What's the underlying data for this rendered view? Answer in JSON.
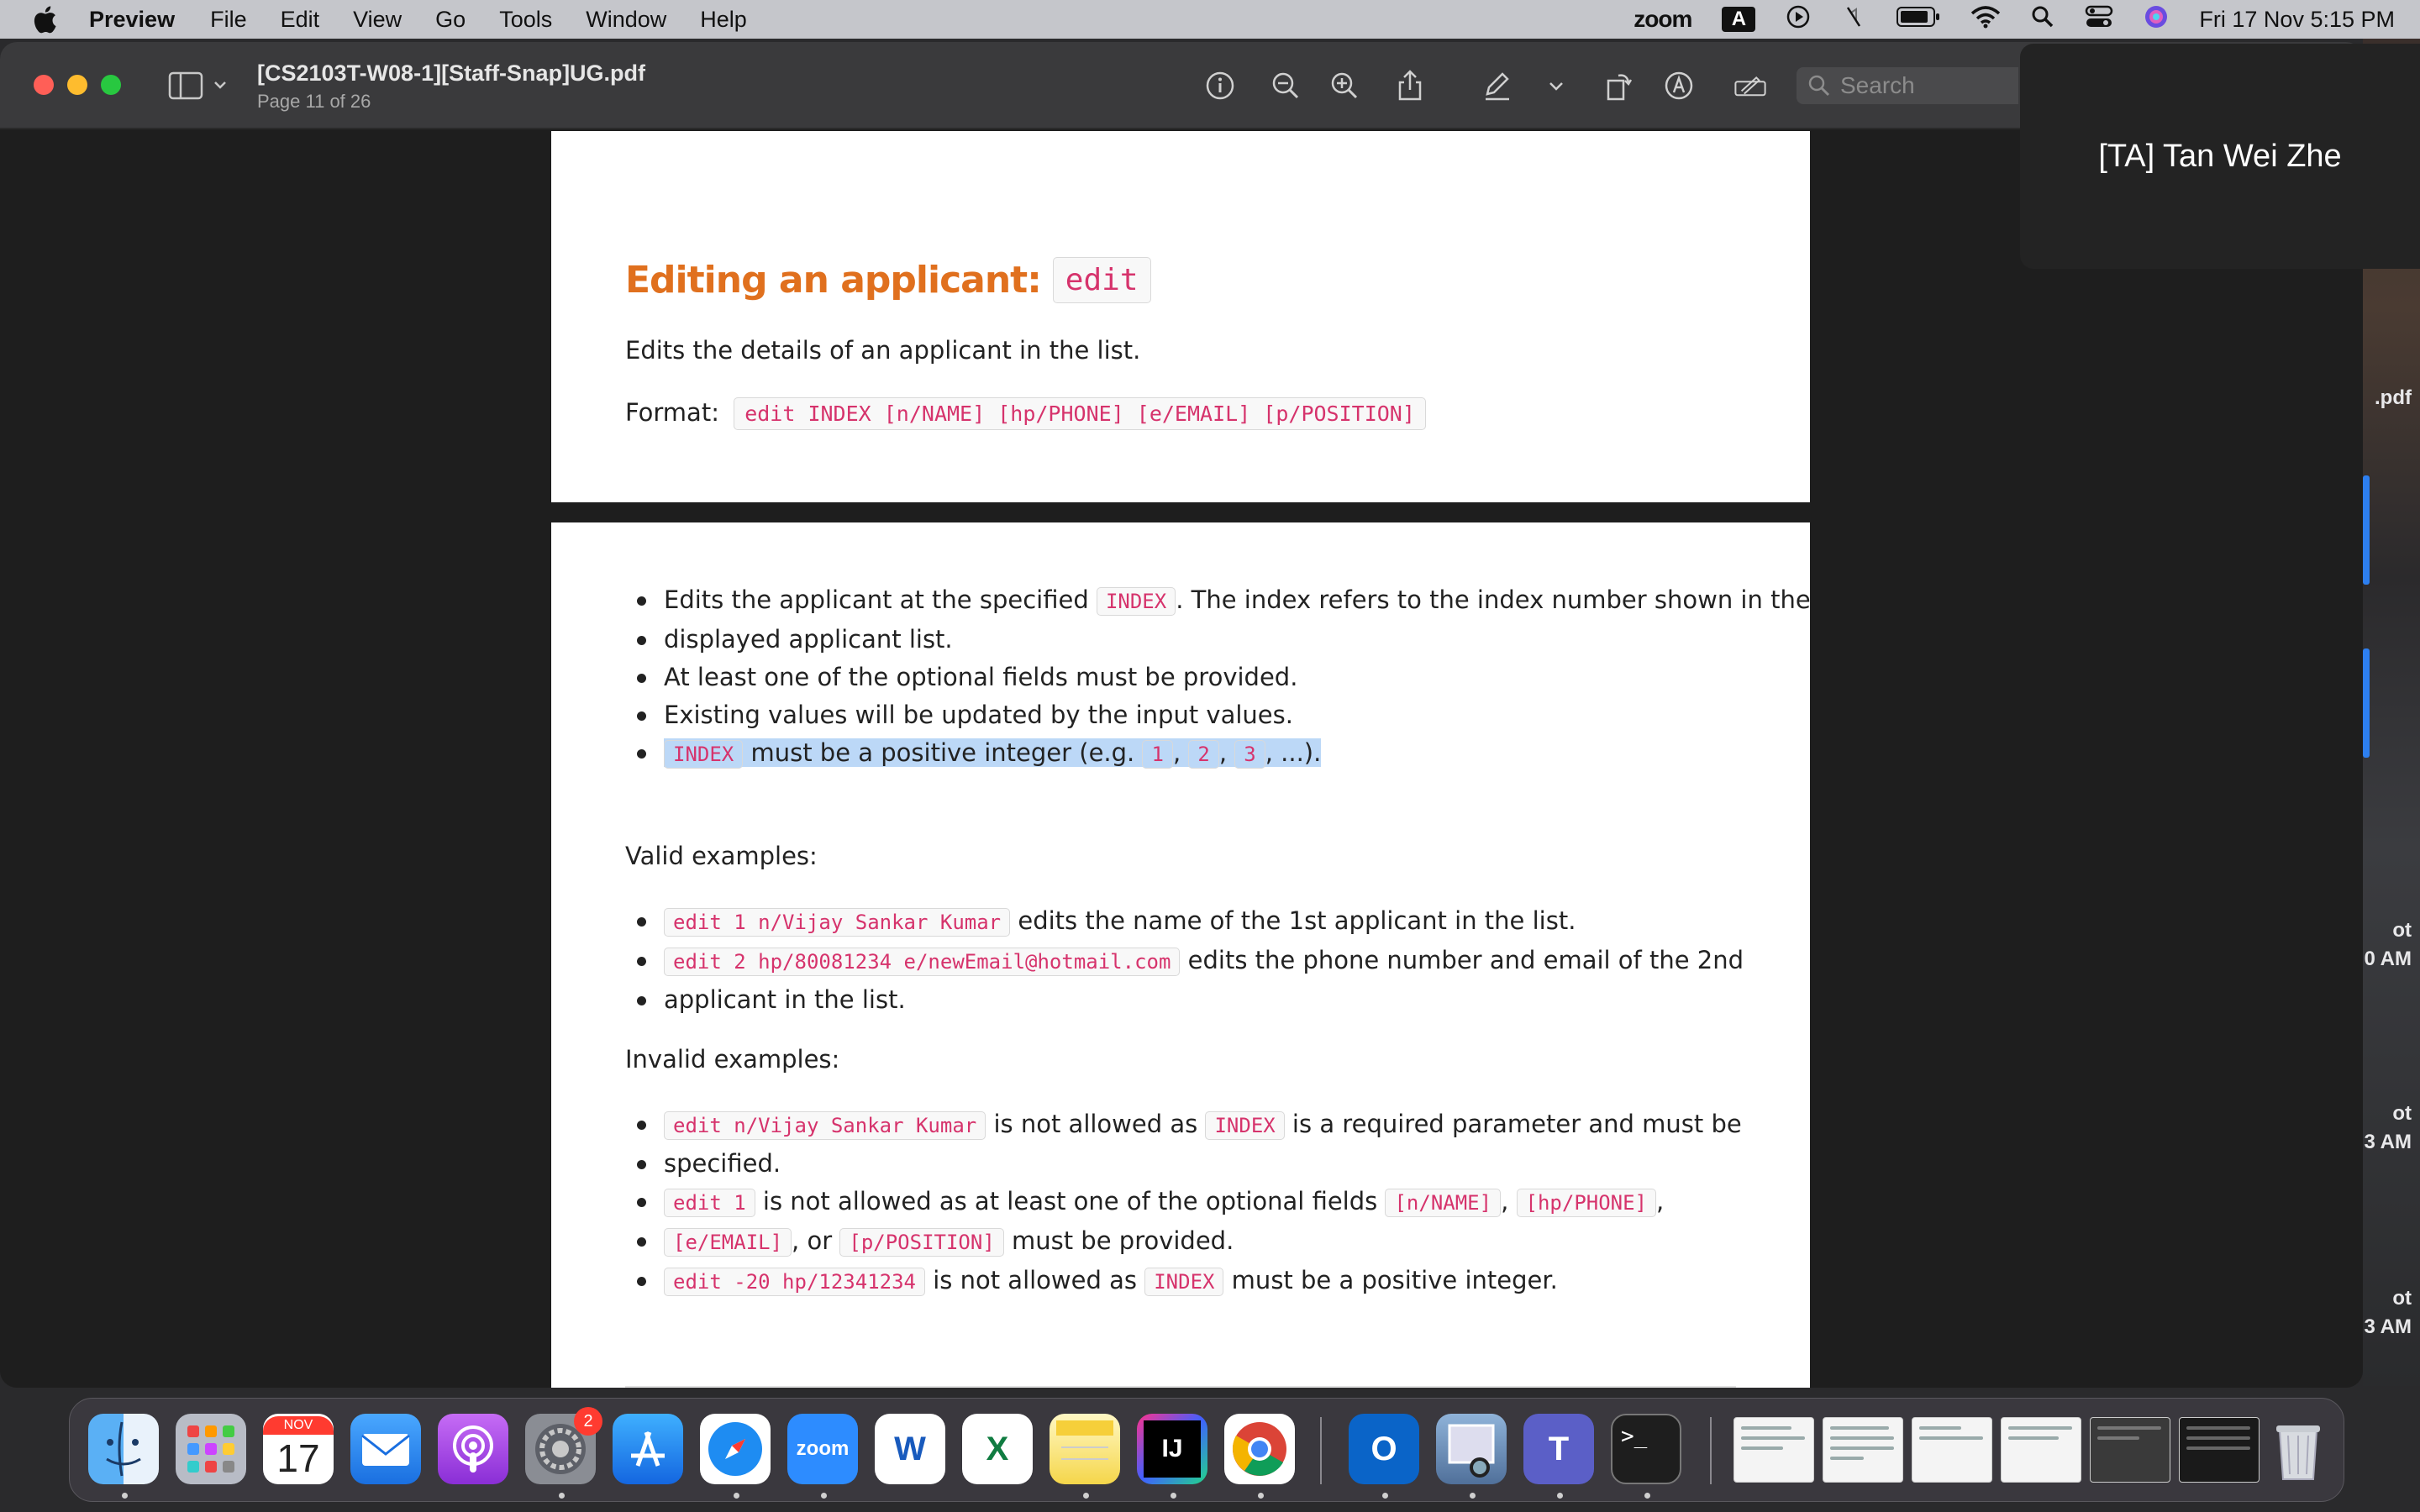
{
  "menubar": {
    "app_name": "Preview",
    "menus": [
      "File",
      "Edit",
      "View",
      "Go",
      "Tools",
      "Window",
      "Help"
    ],
    "status": {
      "zoom_label": "zoom",
      "input_badge": "A",
      "datetime": "Fri 17 Nov  5:15 PM"
    }
  },
  "window": {
    "title": "[CS2103T-W08-1][Staff-Snap]UG.pdf",
    "subtitle": "Page 11 of 26",
    "search_placeholder": "Search"
  },
  "zoom_overlay": {
    "participant": "[TA] Tan Wei Zhe"
  },
  "desktop_fragments": [
    ".pdf",
    "ot",
    "0 AM",
    "ot",
    "3 AM",
    "ot",
    "3 AM"
  ],
  "doc": {
    "heading_text": "Editing an applicant:",
    "heading_code": "edit",
    "description": "Edits the details of an applicant in the list.",
    "format_label": "Format:",
    "format_code": "edit INDEX [n/NAME] [hp/PHONE] [e/EMAIL] [p/POSITION]",
    "bullets": {
      "b1_a": "Edits the applicant at the specified",
      "b1_code": "INDEX",
      "b1_b": ". The index refers to the index number shown in the",
      "b1_c": "displayed applicant list.",
      "b2": "At least one of the optional fields must be provided.",
      "b3": "Existing values will be updated by the input values.",
      "b4_code": "INDEX",
      "b4_a": " must be a positive integer (e.g. ",
      "b4_c1": "1",
      "b4_c2": "2",
      "b4_c3": "3",
      "b4_sep": ", ",
      "b4_end": ", ...)."
    },
    "valid_label": "Valid examples:",
    "valid": {
      "v1_code": "edit 1 n/Vijay Sankar Kumar",
      "v1_text": " edits the name of the 1st applicant in the list.",
      "v2_code": "edit 2 hp/80081234 e/newEmail@hotmail.com",
      "v2_text": " edits the phone number and email of the 2nd",
      "v2_text2": "applicant in the list."
    },
    "invalid_label": "Invalid examples:",
    "invalid": {
      "i1_code": "edit n/Vijay Sankar Kumar",
      "i1_a": " is not allowed as ",
      "i1_code2": "INDEX",
      "i1_b": " is a required parameter and must be",
      "i1_c": "specified.",
      "i2_code": "edit 1",
      "i2_a": " is not allowed as at least one of the optional fields ",
      "i2_c1": "[n/NAME]",
      "i2_c2": "[hp/PHONE]",
      "i2_c3": "[e/EMAIL]",
      "i2_or": ", or ",
      "i2_c4": "[p/POSITION]",
      "i2_b": " must be provided.",
      "i3_code": "edit -20 hp/12341234",
      "i3_a": " is not allowed as ",
      "i3_code2": "INDEX",
      "i3_b": " must be a positive integer."
    }
  },
  "dock": {
    "calendar_month": "NOV",
    "calendar_day": "17",
    "settings_badge": "2",
    "zoom_label": "zoom",
    "word_letter": "W",
    "excel_letter": "X",
    "intellij_letter": "IJ",
    "outlook_letter": "O",
    "teams_letter": "T",
    "terminal_prompt": ">_"
  },
  "colors": {
    "heading": "#e0701e",
    "code_text": "#d6336c",
    "selection": "#bcd8f7",
    "menubar": "#c5c6cb"
  }
}
